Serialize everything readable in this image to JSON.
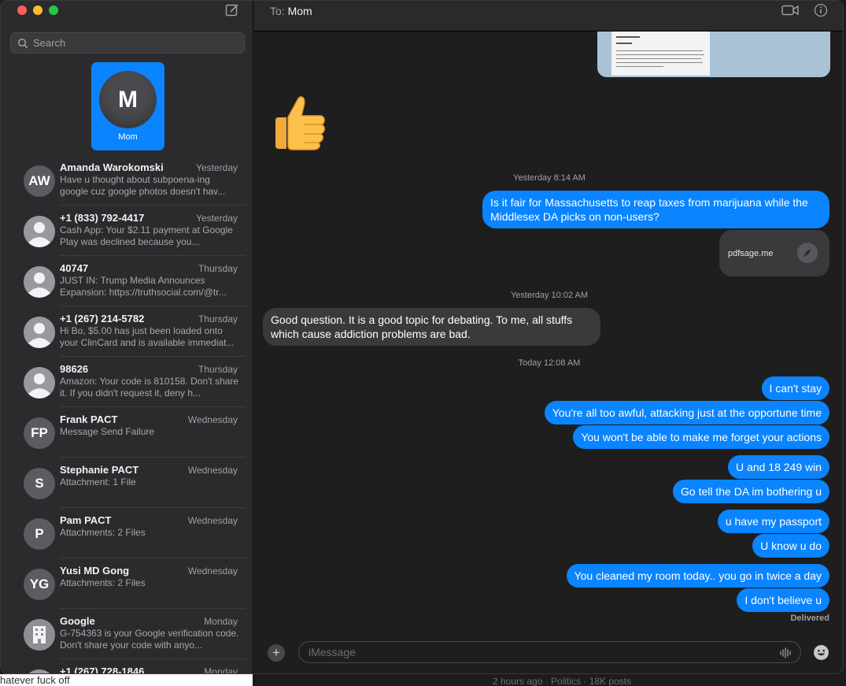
{
  "sidebar": {
    "search_placeholder": "Search",
    "pinned": {
      "initial": "M",
      "name": "Mom"
    },
    "conversations": [
      {
        "avatar": "AW",
        "name": "Amanda Warokomski",
        "when": "Yesterday",
        "preview": "Have u thought about subpoena-ing google cuz google photos doesn't hav..."
      },
      {
        "avatar": "person-icon",
        "name": "+1 (833) 792-4417",
        "when": "Yesterday",
        "preview": "Cash App: Your $2.11 payment at Google Play was declined because you..."
      },
      {
        "avatar": "person-icon",
        "name": "40747",
        "when": "Thursday",
        "preview": "JUST IN: Trump Media Announces Expansion: https://truthsocial.com/@tr..."
      },
      {
        "avatar": "person-icon",
        "name": "+1 (267) 214-5782",
        "when": "Thursday",
        "preview": "Hi Bo, $5.00 has just been loaded onto your ClinCard and is available immediat..."
      },
      {
        "avatar": "person-icon",
        "name": "98626",
        "when": "Thursday",
        "preview": "Amazon: Your code is 810158. Don't share it. If you didn't request it, deny h..."
      },
      {
        "avatar": "FP",
        "name": "Frank PACT",
        "when": "Wednesday",
        "preview": "Message Send Failure"
      },
      {
        "avatar": "S",
        "name": "Stephanie PACT",
        "when": "Wednesday",
        "preview": "Attachment: 1 File"
      },
      {
        "avatar": "P",
        "name": "Pam PACT",
        "when": "Wednesday",
        "preview": "Attachments: 2 Files"
      },
      {
        "avatar": "YG",
        "name": "Yusi MD Gong",
        "when": "Wednesday",
        "preview": "Attachments: 2 Files"
      },
      {
        "avatar": "building-icon",
        "name": "Google",
        "when": "Monday",
        "preview": "G-754363 is your Google verification code. Don't share your code with anyo..."
      },
      {
        "avatar": "person-icon",
        "name": "+1 (267) 728-1846",
        "when": "Monday",
        "preview": ""
      }
    ]
  },
  "header": {
    "to_label": "To:",
    "recipient": "Mom"
  },
  "thread": {
    "stamp1": "Yesterday 8:14 AM",
    "stamp2": "Yesterday 10:02 AM",
    "stamp3": "Today 12:08 AM",
    "msg_question": "Is it fair for Massachusetts to reap taxes from marijuana while the Middlesex DA picks on non-users?",
    "link_url": "pdfsage.me",
    "msg_reply": "Good question. It is a good topic for debating. To me, all stuffs which cause addiction problems are bad.",
    "outgoing": [
      "I can't stay",
      "You're all too awful, attacking just at the opportune time",
      "You won't be able to make me forget your actions",
      "U and 18 249 win",
      "Go tell the DA im bothering u",
      "u have my passport",
      "U know u do",
      "You cleaned my room today..  you go in twice a day",
      "I don't believe u"
    ],
    "delivered": "Delivered"
  },
  "composer": {
    "placeholder": "iMessage"
  },
  "background": {
    "left_text": "hatever fuck off",
    "right_text": "2 hours ago · Politics · 18K posts"
  },
  "colors": {
    "accent": "#0a84ff",
    "incoming": "#3a3a3c",
    "sidebar": "#2b2b2d"
  }
}
